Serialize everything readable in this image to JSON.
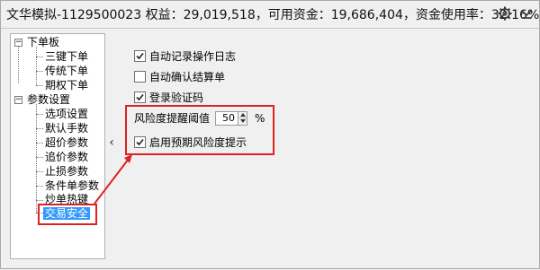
{
  "titlebar": {
    "title": "文华模拟-1129500023  权益：29,019,518，可用资金：19,686,404，资金使用率：32.16%",
    "icons": [
      "gear-icon",
      "chevron-down-icon"
    ]
  },
  "tree": {
    "groups": [
      {
        "label": "下单板",
        "expanded_symbol": "−",
        "children": [
          "三键下单",
          "传统下单",
          "期权下单"
        ]
      },
      {
        "label": "参数设置",
        "expanded_symbol": "−",
        "children": [
          "选项设置",
          "默认手数",
          "超价参数",
          "追价参数",
          "止损参数",
          "条件单参数",
          "炒单热键",
          "交易安全"
        ]
      }
    ],
    "selected": "交易安全"
  },
  "collapse_arrow": "‹",
  "options": [
    {
      "label": "自动记录操作日志",
      "checked": true
    },
    {
      "label": "自动确认结算单",
      "checked": false
    },
    {
      "label": "登录验证码",
      "checked": true
    }
  ],
  "risk": {
    "threshold_label": "风险度提醒阈值",
    "threshold_value": "50",
    "unit": "%",
    "expected_risk_label": "启用预期风险度提示",
    "expected_risk_checked": true
  },
  "colors": {
    "highlight": "#dd2222",
    "selection": "#3399ff"
  }
}
